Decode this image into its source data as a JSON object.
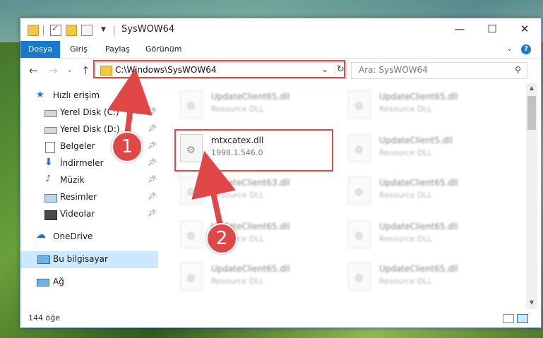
{
  "window": {
    "title": "SysWOW64",
    "controls": {
      "minimize": "—",
      "maximize": "☐",
      "close": "✕"
    }
  },
  "ribbon": {
    "tabs": [
      "Dosya",
      "Giriş",
      "Paylaş",
      "Görünüm"
    ],
    "help": "?"
  },
  "nav": {
    "address": "C:\\Windows\\SysWOW64",
    "search_placeholder": "Ara: SysWOW64"
  },
  "sidebar": {
    "items": [
      {
        "label": "Hızlı erişim",
        "icon": "star-icon",
        "pinned": false
      },
      {
        "label": "Yerel Disk (C:)",
        "icon": "drive-icon",
        "pinned": true
      },
      {
        "label": "Yerel Disk (D:)",
        "icon": "drive-icon",
        "pinned": true
      },
      {
        "label": "Belgeler",
        "icon": "documents-icon",
        "pinned": true
      },
      {
        "label": "İndirmeler",
        "icon": "download-icon",
        "pinned": true
      },
      {
        "label": "Müzik",
        "icon": "music-icon",
        "pinned": true
      },
      {
        "label": "Resimler",
        "icon": "pictures-icon",
        "pinned": true
      },
      {
        "label": "Videolar",
        "icon": "video-icon",
        "pinned": true
      },
      {
        "label": "OneDrive",
        "icon": "cloud-icon",
        "pinned": false
      },
      {
        "label": "Bu bilgisayar",
        "icon": "computer-icon",
        "pinned": false
      },
      {
        "label": "Ağ",
        "icon": "network-icon",
        "pinned": false
      }
    ]
  },
  "files": {
    "highlighted": {
      "name": "mtxcatex.dll",
      "version": "1998.1.546.0"
    },
    "left_column": [
      {
        "name": "UpdateClient65.dll",
        "sub": "Resource DLL"
      },
      {
        "name": "UpdateClient63.dll",
        "sub": "Resource DLL"
      },
      {
        "name": "UpdateClient65.dll",
        "sub": "Resource DLL"
      },
      {
        "name": "UpdateClient65.dll",
        "sub": "Resource DLL"
      }
    ],
    "right_column": [
      {
        "name": "UpdateClient65.dll",
        "sub": "Resource DLL"
      },
      {
        "name": "UpdateClient5.dll",
        "sub": "Resource DLL"
      },
      {
        "name": "UpdateClient65.dll",
        "sub": "Resource DLL"
      },
      {
        "name": "UpdateClient65.dll",
        "sub": "Resource DLL"
      },
      {
        "name": "UpdateClient65.dll",
        "sub": "Resource DLL"
      }
    ]
  },
  "status": {
    "count": "144 öğe"
  },
  "annotations": {
    "step1": "1",
    "step2": "2",
    "color": "#e04848"
  }
}
